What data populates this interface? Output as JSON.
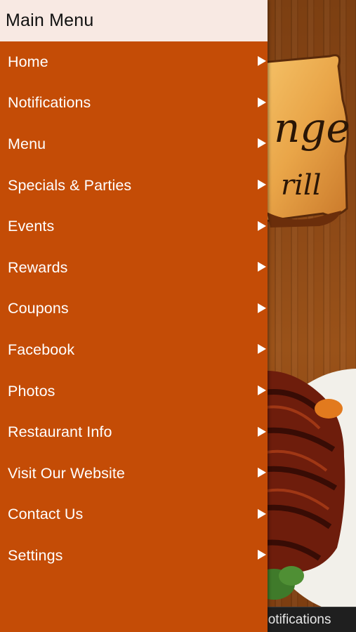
{
  "drawer": {
    "title": "Main Menu",
    "items": [
      {
        "label": "Home",
        "icon": "chevron-right-icon"
      },
      {
        "label": "Notifications",
        "icon": "chevron-right-icon"
      },
      {
        "label": "Menu",
        "icon": "chevron-right-icon"
      },
      {
        "label": "Specials & Parties",
        "icon": "chevron-right-icon"
      },
      {
        "label": "Events",
        "icon": "chevron-right-icon"
      },
      {
        "label": "Rewards",
        "icon": "chevron-right-icon"
      },
      {
        "label": "Coupons",
        "icon": "chevron-right-icon"
      },
      {
        "label": "Facebook",
        "icon": "chevron-right-icon"
      },
      {
        "label": "Photos",
        "icon": "chevron-right-icon"
      },
      {
        "label": "Restaurant Info",
        "icon": "chevron-right-icon"
      },
      {
        "label": "Visit Our Website",
        "icon": "chevron-right-icon"
      },
      {
        "label": "Contact Us",
        "icon": "chevron-right-icon"
      },
      {
        "label": "Settings",
        "icon": "chevron-right-icon"
      }
    ]
  },
  "background": {
    "sign_text_top": "nge",
    "sign_text_bottom": "rill",
    "bottom_bar_label": "Notifications"
  },
  "colors": {
    "drawer_bg": "#c44c06",
    "header_bg": "#f8e9e3",
    "wood": "#8a4716",
    "bottom_bar": "#1f1f1f"
  }
}
